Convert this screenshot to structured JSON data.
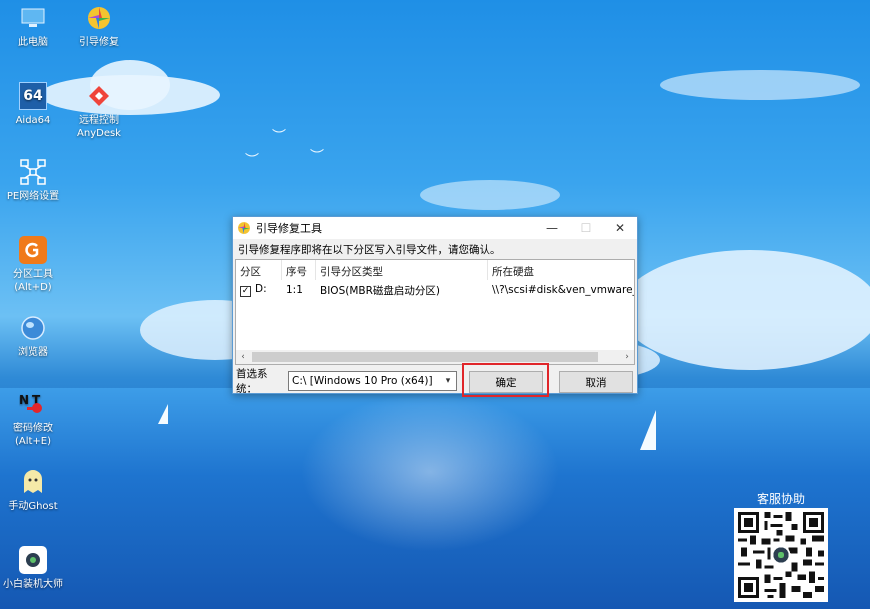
{
  "desktop": {
    "icons": [
      {
        "label": "此电脑"
      },
      {
        "label": "引导修复"
      },
      {
        "label": "Aida64"
      },
      {
        "label": "远程控制\nAnyDesk"
      },
      {
        "label": "PE网络设置"
      },
      {
        "label": "分区工具\n(Alt+D)"
      },
      {
        "label": "浏览器"
      },
      {
        "label": "密码修改\n(Alt+E)"
      },
      {
        "label": "手动Ghost"
      },
      {
        "label": "小白装机大师"
      }
    ],
    "aida_badge": "64"
  },
  "window": {
    "title": "引导修复工具",
    "message": "引导修复程序即将在以下分区写入引导文件，请您确认。",
    "columns": [
      "分区",
      "序号",
      "引导分区类型",
      "所在硬盘"
    ],
    "rows": [
      {
        "checked": true,
        "partition": "D:",
        "index": "1:1",
        "type": "BIOS(MBR磁盘启动分区)",
        "disk": "\\\\?\\scsi#disk&ven_vmware_&"
      }
    ],
    "preferred_label": "首选系统：",
    "preferred_value": "C:\\ [Windows 10 Pro (x64)]",
    "confirm_label": "确定",
    "cancel_label": "取消",
    "controls": {
      "minimize": "—",
      "maximize": "☐",
      "close": "✕"
    }
  },
  "qr": {
    "title": "客服协助"
  },
  "colors": {
    "accent": "#0078d7",
    "highlight": "#e0262a"
  }
}
